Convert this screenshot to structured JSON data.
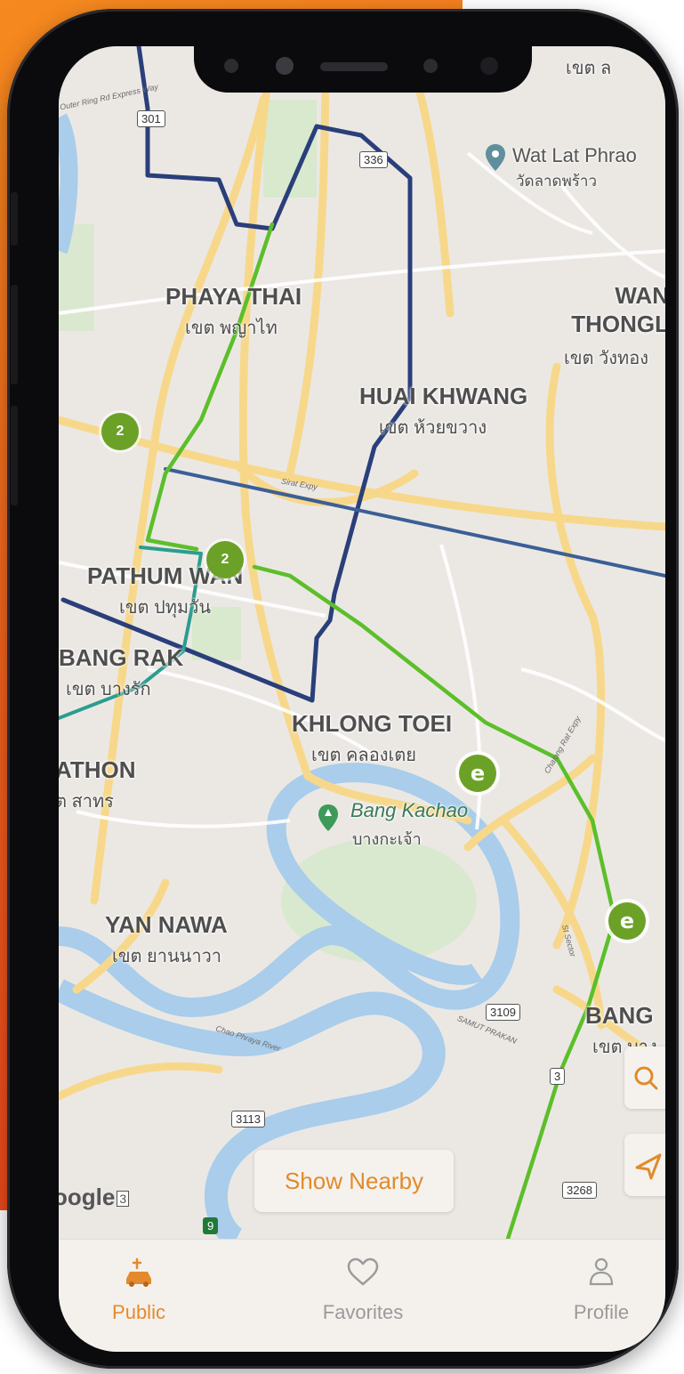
{
  "map": {
    "districts": [
      {
        "en": "PHAYA THAI",
        "th": "เขต พญาไท"
      },
      {
        "en": "HUAI KHWANG",
        "th": "เขต ห้วยขวาง"
      },
      {
        "en": "PATHUM WAN",
        "th": "เขต ปทุมวัน"
      },
      {
        "en": "BANG RAK",
        "th": "เขต บางรัก"
      },
      {
        "en": "KHLONG TOEI",
        "th": "เขต คลองเตย"
      },
      {
        "en": "ATHON",
        "th": "ต สาทร"
      },
      {
        "en": "YAN NAWA",
        "th": "เขต ยานนาวา"
      },
      {
        "en": "WAN THONGL",
        "th": "เขต วังทอง"
      },
      {
        "en": "BANG",
        "th": "เขต บาง"
      }
    ],
    "edge_label_top": "เขต ล",
    "poi": [
      {
        "en": "Wat Lat Phrao",
        "th": "วัดลาดพร้าว"
      },
      {
        "en": "Bang Kachao",
        "th": "บางกะเจ้า"
      }
    ],
    "route_shields": [
      "301",
      "336",
      "3109",
      "3",
      "3113",
      "3268",
      "9"
    ],
    "road_labels": [
      "Outer Ring Rd Express Way",
      "Sirat Expy",
      "Chalong Rat Expy",
      "Chao Phraya River",
      "SAMUT PRAKAN",
      "St Sector"
    ],
    "clusters": [
      {
        "count": "2"
      },
      {
        "count": "2"
      }
    ],
    "station_icon_label": "e",
    "google_logo": "oogle"
  },
  "show_nearby_label": "Show Nearby",
  "fabs": [
    {
      "icon": "search-icon"
    },
    {
      "icon": "navigation-arrow-icon"
    }
  ],
  "tabbar": {
    "tabs": [
      {
        "label": "Public",
        "icon": "charging-car-icon",
        "active": true
      },
      {
        "label": "Favorites",
        "icon": "heart-icon",
        "active": false
      },
      {
        "label": "Profile",
        "icon": "person-icon",
        "active": false
      }
    ]
  },
  "colors": {
    "accent": "#e38b2c",
    "route_green": "#5cbf2a",
    "route_navy": "#2a3f7a",
    "route_blue": "#3b5f96",
    "route_teal": "#2a9d8f",
    "water": "#a9cdeb",
    "road": "#f7d88b",
    "orange_bg": "#f2691e"
  }
}
